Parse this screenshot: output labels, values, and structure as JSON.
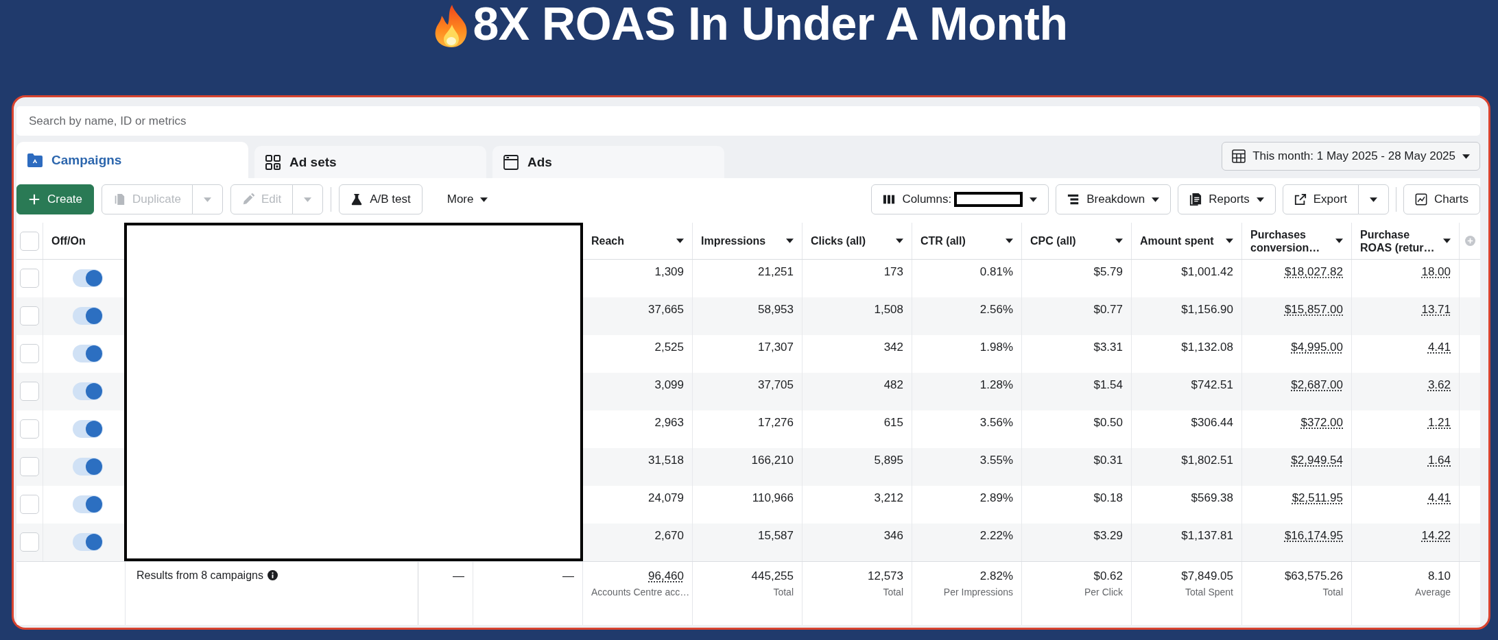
{
  "title": "8X ROAS In Under A Month",
  "search": {
    "placeholder": "Search by name, ID or metrics"
  },
  "tabs": [
    {
      "label": "Campaigns",
      "selected": true
    },
    {
      "label": "Ad sets",
      "selected": false
    },
    {
      "label": "Ads",
      "selected": false
    }
  ],
  "date_range": {
    "label": "This month: 1 May 2025 - 28 May 2025"
  },
  "toolbar": {
    "left": [
      {
        "label": "Create",
        "kind": "primary",
        "disabled": false
      },
      {
        "label": "Duplicate",
        "kind": "split",
        "disabled": true
      },
      {
        "label": "Edit",
        "kind": "split",
        "disabled": true
      },
      {
        "label": "A/B test",
        "kind": "outline",
        "disabled": false
      },
      {
        "label": "More",
        "kind": "textmenu",
        "disabled": false
      }
    ],
    "right": [
      {
        "label": "Columns:",
        "kind": "columns",
        "disabled": false
      },
      {
        "label": "Breakdown",
        "kind": "menu",
        "disabled": false
      },
      {
        "label": "Reports",
        "kind": "menu",
        "disabled": false
      },
      {
        "label": "Export",
        "kind": "split",
        "disabled": false
      },
      {
        "label": "Charts",
        "kind": "outline",
        "disabled": false
      }
    ]
  },
  "table": {
    "select_all": {
      "checked": false
    },
    "columns": [
      {
        "label": "Off/On",
        "kind": "toggle"
      },
      {
        "label": "Reach",
        "kind": "metric",
        "link": false
      },
      {
        "label": "Impressions",
        "kind": "metric",
        "link": false
      },
      {
        "label": "Clicks (all)",
        "kind": "metric",
        "link": false
      },
      {
        "label": "CTR (all)",
        "kind": "metric",
        "link": false
      },
      {
        "label": "CPC (all)",
        "kind": "metric",
        "link": false
      },
      {
        "label": "Amount spent",
        "kind": "metric",
        "link": false
      },
      {
        "label": "Purchases conversion…",
        "kind": "metric",
        "link": true
      },
      {
        "label": "Purchase ROAS (retur…",
        "kind": "metric",
        "link": true
      }
    ],
    "rows": [
      {
        "checked": false,
        "on": true,
        "values": [
          "1,309",
          "21,251",
          "173",
          "0.81%",
          "$5.79",
          "$1,001.42",
          "$18,027.82",
          "18.00"
        ]
      },
      {
        "checked": false,
        "on": true,
        "values": [
          "37,665",
          "58,953",
          "1,508",
          "2.56%",
          "$0.77",
          "$1,156.90",
          "$15,857.00",
          "13.71"
        ]
      },
      {
        "checked": false,
        "on": true,
        "values": [
          "2,525",
          "17,307",
          "342",
          "1.98%",
          "$3.31",
          "$1,132.08",
          "$4,995.00",
          "4.41"
        ]
      },
      {
        "checked": false,
        "on": true,
        "values": [
          "3,099",
          "37,705",
          "482",
          "1.28%",
          "$1.54",
          "$742.51",
          "$2,687.00",
          "3.62"
        ]
      },
      {
        "checked": false,
        "on": true,
        "values": [
          "2,963",
          "17,276",
          "615",
          "3.56%",
          "$0.50",
          "$306.44",
          "$372.00",
          "1.21"
        ]
      },
      {
        "checked": false,
        "on": true,
        "values": [
          "31,518",
          "166,210",
          "5,895",
          "3.55%",
          "$0.31",
          "$1,802.51",
          "$2,949.54",
          "1.64"
        ]
      },
      {
        "checked": false,
        "on": true,
        "values": [
          "24,079",
          "110,966",
          "3,212",
          "2.89%",
          "$0.18",
          "$569.38",
          "$2,511.95",
          "4.41"
        ]
      },
      {
        "checked": false,
        "on": true,
        "values": [
          "2,670",
          "15,587",
          "346",
          "2.22%",
          "$3.29",
          "$1,137.81",
          "$16,174.95",
          "14.22"
        ]
      }
    ],
    "footer": {
      "label": "Results from 8 campaigns",
      "cells": [
        {
          "value": "—",
          "link": false
        },
        {
          "value": "—",
          "link": false
        },
        {
          "value": "96,460",
          "note": "Accounts Centre acc…",
          "link": true
        },
        {
          "value": "445,255",
          "note": "Total",
          "link": false
        },
        {
          "value": "12,573",
          "note": "Total",
          "link": false
        },
        {
          "value": "2.82%",
          "note": "Per Impressions",
          "link": false
        },
        {
          "value": "$0.62",
          "note": "Per Click",
          "link": false
        },
        {
          "value": "$7,849.05",
          "note": "Total Spent",
          "link": false
        },
        {
          "value": "$63,575.26",
          "note": "Total",
          "link": false
        },
        {
          "value": "8.10",
          "note": "Average",
          "link": false
        }
      ]
    }
  }
}
